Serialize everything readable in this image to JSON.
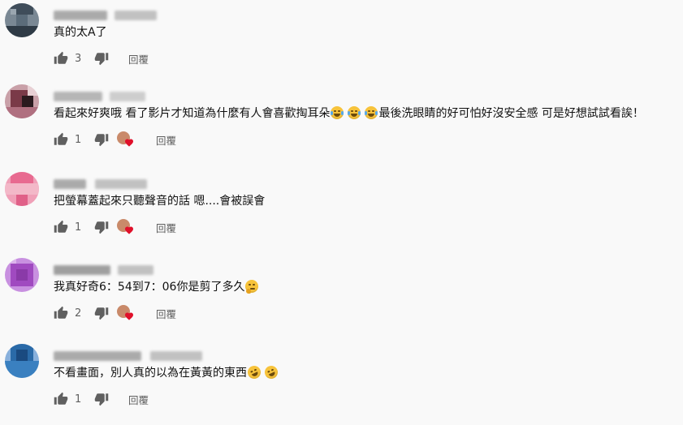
{
  "reply_label": "回覆",
  "comments": [
    {
      "text": "真的太A了",
      "likes": "3",
      "hearted": false,
      "avatar_color": "#4a5a6a"
    },
    {
      "text": "看起來好爽哦 看了影片才知道為什麼有人會喜歡掏耳朵",
      "text_after": "最後洗眼睛的好可怕好沒安全感 可是好想試試看誒！",
      "emojis": [
        "face-with-tears-of-joy",
        "face-with-tears-of-joy",
        "face-with-tears-of-joy"
      ],
      "likes": "1",
      "hearted": true,
      "avatar_color": "#7a3a48"
    },
    {
      "text": "把螢幕蓋起來只聽聲音的話 嗯....會被誤會",
      "likes": "1",
      "hearted": true,
      "avatar_color": "#e07890"
    },
    {
      "text": "我真好奇6：54到7：06你是剪了多久",
      "emojis": [
        "thinking-face"
      ],
      "likes": "2",
      "hearted": true,
      "avatar_color": "#a04ac0"
    },
    {
      "text": "不看畫面，別人真的以為在黃黃的東西",
      "emojis": [
        "rolling-on-floor-laughing",
        "rolling-on-floor-laughing"
      ],
      "likes": "1",
      "hearted": false,
      "avatar_color": "#2a6aa8"
    }
  ]
}
